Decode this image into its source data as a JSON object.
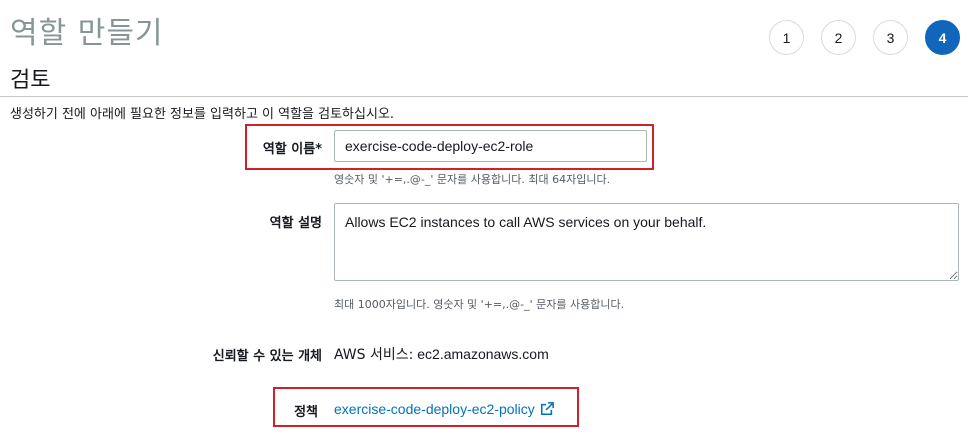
{
  "header": {
    "title": "역할 만들기",
    "steps": [
      "1",
      "2",
      "3",
      "4"
    ],
    "active_step": "4"
  },
  "section": {
    "title": "검토",
    "description": "생성하기 전에 아래에 필요한 정보를 입력하고 이 역할을 검토하십시오."
  },
  "role_name": {
    "label": "역할 이름*",
    "value": "exercise-code-deploy-ec2-role",
    "hint": "영숫자 및 '+=,.@-_' 문자를 사용합니다. 최대 64자입니다."
  },
  "role_description": {
    "label": "역할 설명",
    "value": "Allows EC2 instances to call AWS services on your behalf.",
    "hint": "최대 1000자입니다. 영숫자 및 '+=,.@-_' 문자를 사용합니다."
  },
  "trusted_entity": {
    "label": "신뢰할 수 있는 개체",
    "prefix": "AWS 서비스:",
    "value": "ec2.amazonaws.com"
  },
  "policy": {
    "label": "정책",
    "link_text": "exercise-code-deploy-ec2-policy",
    "icon": "external-link-icon"
  },
  "colors": {
    "accent": "#1166bb",
    "link": "#0073bb",
    "highlight": "#d0202a"
  }
}
